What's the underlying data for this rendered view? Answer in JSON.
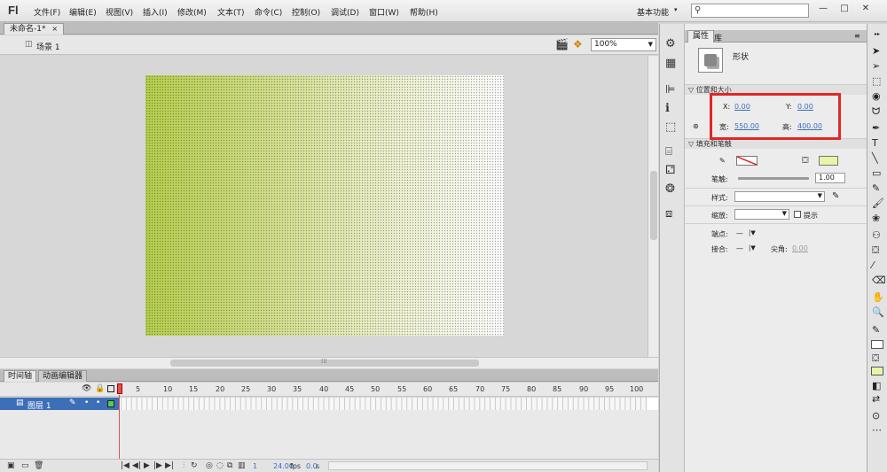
{
  "app": {
    "logo": "Fl"
  },
  "menu": [
    "文件(F)",
    "编辑(E)",
    "视图(V)",
    "插入(I)",
    "修改(M)",
    "文本(T)",
    "命令(C)",
    "控制(O)",
    "调试(D)",
    "窗口(W)",
    "帮助(H)"
  ],
  "workspace": {
    "label": "基本功能",
    "caret": "▾"
  },
  "search": {
    "icon": "search-icon",
    "placeholder": ""
  },
  "window": {
    "minimize": "—",
    "maximize": "□",
    "close": "✕"
  },
  "document": {
    "tab": "未命名-1*",
    "close": "×",
    "scene": "场景 1",
    "zoom": "100%"
  },
  "timeline": {
    "tabs": [
      "时间轴",
      "动画编辑器"
    ],
    "frame_numbers": [
      "5",
      "10",
      "15",
      "20",
      "25",
      "30",
      "35",
      "40",
      "45",
      "50",
      "55",
      "60",
      "65",
      "70",
      "75",
      "80",
      "85",
      "90",
      "95",
      "100"
    ],
    "layer_name": "图层 1",
    "playhead_frame": "1",
    "current_frame": "1",
    "fps": "24.00",
    "fps_unit": "fps",
    "elapsed": "0.0",
    "elapsed_unit": "s"
  },
  "properties": {
    "tabs": [
      "属性",
      "库"
    ],
    "object_type": "形状",
    "position_section": "位置和大小",
    "x_label": "X:",
    "x_value": "0.00",
    "y_label": "Y:",
    "y_value": "0.00",
    "width_label": "宽:",
    "width_value": "550.00",
    "height_label": "高:",
    "height_value": "400.00",
    "fill_stroke_section": "填充和笔触",
    "stroke_label": "笔触:",
    "stroke_value": "1.00",
    "style_label": "样式:",
    "scale_label": "缩放:",
    "hint_label": "提示",
    "cap_label": "端点:",
    "cap_value": "—",
    "join_label": "接合:",
    "join_value": "—",
    "miter_label": "尖角:",
    "miter_value": "0.00"
  },
  "colors": {
    "stage_gradient_start": "#b6d04a",
    "stage_gradient_end": "#ffffff",
    "fill_color": "#e8f5a8",
    "layer_selected": "#3d6fb8",
    "layer_color": "#4cd24c",
    "highlight": "#e32626",
    "link_blue": "#3a6fc2"
  }
}
